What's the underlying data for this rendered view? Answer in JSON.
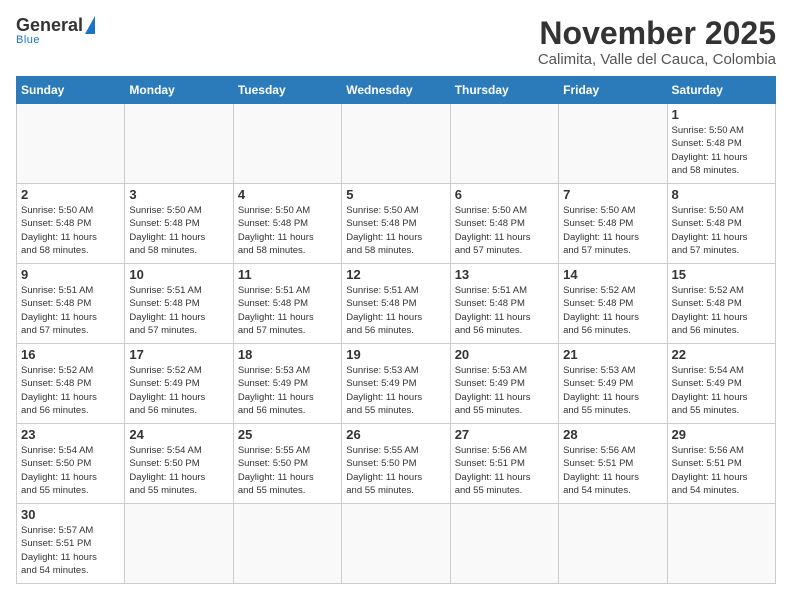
{
  "header": {
    "logo_general": "General",
    "logo_blue": "Blue",
    "calendar_title": "November 2025",
    "calendar_subtitle": "Calimita, Valle del Cauca, Colombia"
  },
  "days": [
    "Sunday",
    "Monday",
    "Tuesday",
    "Wednesday",
    "Thursday",
    "Friday",
    "Saturday"
  ],
  "weeks": [
    [
      {
        "date": "",
        "info": ""
      },
      {
        "date": "",
        "info": ""
      },
      {
        "date": "",
        "info": ""
      },
      {
        "date": "",
        "info": ""
      },
      {
        "date": "",
        "info": ""
      },
      {
        "date": "",
        "info": ""
      },
      {
        "date": "1",
        "info": "Sunrise: 5:50 AM\nSunset: 5:48 PM\nDaylight: 11 hours\nand 58 minutes."
      }
    ],
    [
      {
        "date": "2",
        "info": "Sunrise: 5:50 AM\nSunset: 5:48 PM\nDaylight: 11 hours\nand 58 minutes."
      },
      {
        "date": "3",
        "info": "Sunrise: 5:50 AM\nSunset: 5:48 PM\nDaylight: 11 hours\nand 58 minutes."
      },
      {
        "date": "4",
        "info": "Sunrise: 5:50 AM\nSunset: 5:48 PM\nDaylight: 11 hours\nand 58 minutes."
      },
      {
        "date": "5",
        "info": "Sunrise: 5:50 AM\nSunset: 5:48 PM\nDaylight: 11 hours\nand 58 minutes."
      },
      {
        "date": "6",
        "info": "Sunrise: 5:50 AM\nSunset: 5:48 PM\nDaylight: 11 hours\nand 57 minutes."
      },
      {
        "date": "7",
        "info": "Sunrise: 5:50 AM\nSunset: 5:48 PM\nDaylight: 11 hours\nand 57 minutes."
      },
      {
        "date": "8",
        "info": "Sunrise: 5:50 AM\nSunset: 5:48 PM\nDaylight: 11 hours\nand 57 minutes."
      }
    ],
    [
      {
        "date": "9",
        "info": "Sunrise: 5:51 AM\nSunset: 5:48 PM\nDaylight: 11 hours\nand 57 minutes."
      },
      {
        "date": "10",
        "info": "Sunrise: 5:51 AM\nSunset: 5:48 PM\nDaylight: 11 hours\nand 57 minutes."
      },
      {
        "date": "11",
        "info": "Sunrise: 5:51 AM\nSunset: 5:48 PM\nDaylight: 11 hours\nand 57 minutes."
      },
      {
        "date": "12",
        "info": "Sunrise: 5:51 AM\nSunset: 5:48 PM\nDaylight: 11 hours\nand 56 minutes."
      },
      {
        "date": "13",
        "info": "Sunrise: 5:51 AM\nSunset: 5:48 PM\nDaylight: 11 hours\nand 56 minutes."
      },
      {
        "date": "14",
        "info": "Sunrise: 5:52 AM\nSunset: 5:48 PM\nDaylight: 11 hours\nand 56 minutes."
      },
      {
        "date": "15",
        "info": "Sunrise: 5:52 AM\nSunset: 5:48 PM\nDaylight: 11 hours\nand 56 minutes."
      }
    ],
    [
      {
        "date": "16",
        "info": "Sunrise: 5:52 AM\nSunset: 5:48 PM\nDaylight: 11 hours\nand 56 minutes."
      },
      {
        "date": "17",
        "info": "Sunrise: 5:52 AM\nSunset: 5:49 PM\nDaylight: 11 hours\nand 56 minutes."
      },
      {
        "date": "18",
        "info": "Sunrise: 5:53 AM\nSunset: 5:49 PM\nDaylight: 11 hours\nand 56 minutes."
      },
      {
        "date": "19",
        "info": "Sunrise: 5:53 AM\nSunset: 5:49 PM\nDaylight: 11 hours\nand 55 minutes."
      },
      {
        "date": "20",
        "info": "Sunrise: 5:53 AM\nSunset: 5:49 PM\nDaylight: 11 hours\nand 55 minutes."
      },
      {
        "date": "21",
        "info": "Sunrise: 5:53 AM\nSunset: 5:49 PM\nDaylight: 11 hours\nand 55 minutes."
      },
      {
        "date": "22",
        "info": "Sunrise: 5:54 AM\nSunset: 5:49 PM\nDaylight: 11 hours\nand 55 minutes."
      }
    ],
    [
      {
        "date": "23",
        "info": "Sunrise: 5:54 AM\nSunset: 5:50 PM\nDaylight: 11 hours\nand 55 minutes."
      },
      {
        "date": "24",
        "info": "Sunrise: 5:54 AM\nSunset: 5:50 PM\nDaylight: 11 hours\nand 55 minutes."
      },
      {
        "date": "25",
        "info": "Sunrise: 5:55 AM\nSunset: 5:50 PM\nDaylight: 11 hours\nand 55 minutes."
      },
      {
        "date": "26",
        "info": "Sunrise: 5:55 AM\nSunset: 5:50 PM\nDaylight: 11 hours\nand 55 minutes."
      },
      {
        "date": "27",
        "info": "Sunrise: 5:56 AM\nSunset: 5:51 PM\nDaylight: 11 hours\nand 55 minutes."
      },
      {
        "date": "28",
        "info": "Sunrise: 5:56 AM\nSunset: 5:51 PM\nDaylight: 11 hours\nand 54 minutes."
      },
      {
        "date": "29",
        "info": "Sunrise: 5:56 AM\nSunset: 5:51 PM\nDaylight: 11 hours\nand 54 minutes."
      }
    ],
    [
      {
        "date": "30",
        "info": "Sunrise: 5:57 AM\nSunset: 5:51 PM\nDaylight: 11 hours\nand 54 minutes."
      },
      {
        "date": "",
        "info": ""
      },
      {
        "date": "",
        "info": ""
      },
      {
        "date": "",
        "info": ""
      },
      {
        "date": "",
        "info": ""
      },
      {
        "date": "",
        "info": ""
      },
      {
        "date": "",
        "info": ""
      }
    ]
  ]
}
